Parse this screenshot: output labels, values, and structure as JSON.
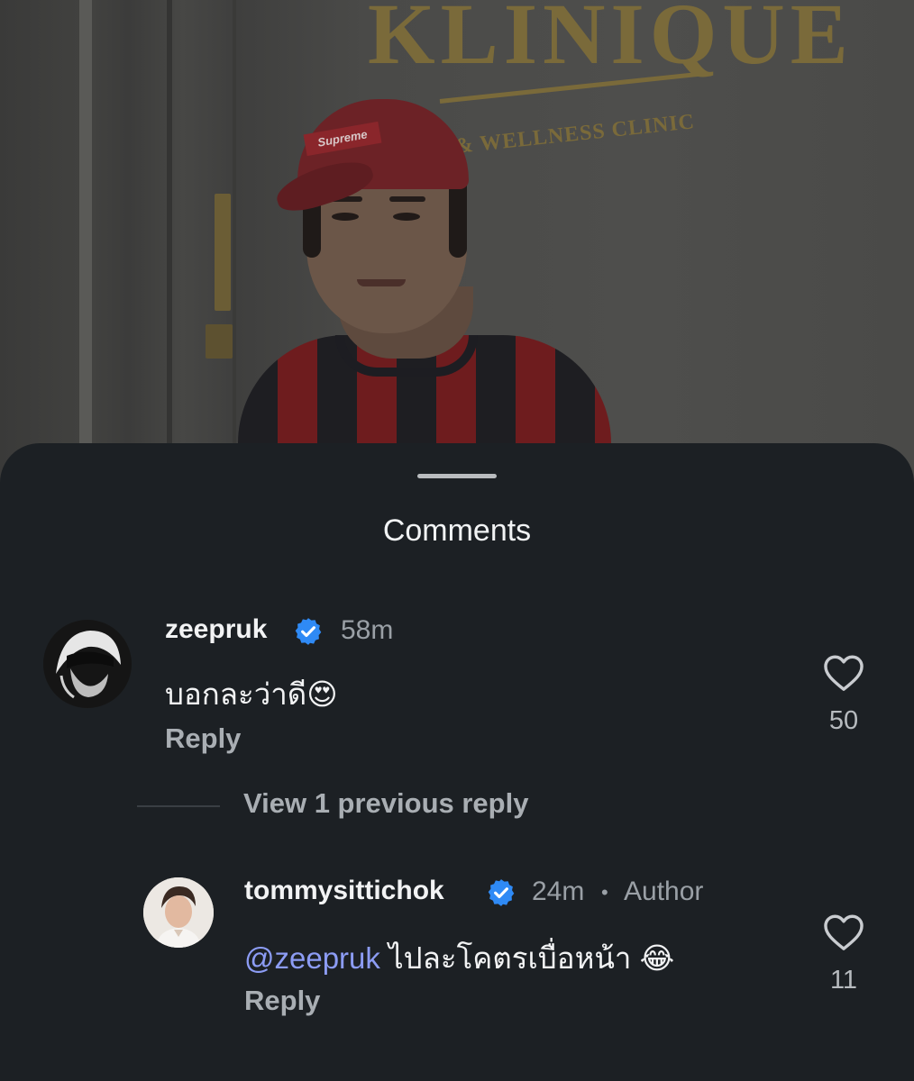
{
  "background_photo": {
    "sign_text": "KLINIQUE",
    "sign_subtext": "& WELLNESS CLINIC",
    "cap_logo": "Supreme"
  },
  "sheet": {
    "title": "Comments"
  },
  "comments": [
    {
      "username": "zeepruk",
      "verified": true,
      "timestamp": "58m",
      "text": "บอกละว่าดี",
      "emoji": "😍",
      "reply_label": "Reply",
      "likes": "50"
    }
  ],
  "view_previous": {
    "label": "View 1 previous reply"
  },
  "replies": [
    {
      "username": "tommysittichok",
      "verified": true,
      "timestamp": "24m",
      "separator": "•",
      "role": "Author",
      "mention": "@zeepruk",
      "text": " ไปละโคตรเบื่อหน้า ",
      "emoji": "😂",
      "reply_label": "Reply",
      "likes": "11"
    }
  ],
  "colors": {
    "sheet_bg": "#1c2024",
    "verified_badge": "#2f8af5",
    "mention": "#8c9cf4",
    "muted_text": "#9aa0a6"
  }
}
